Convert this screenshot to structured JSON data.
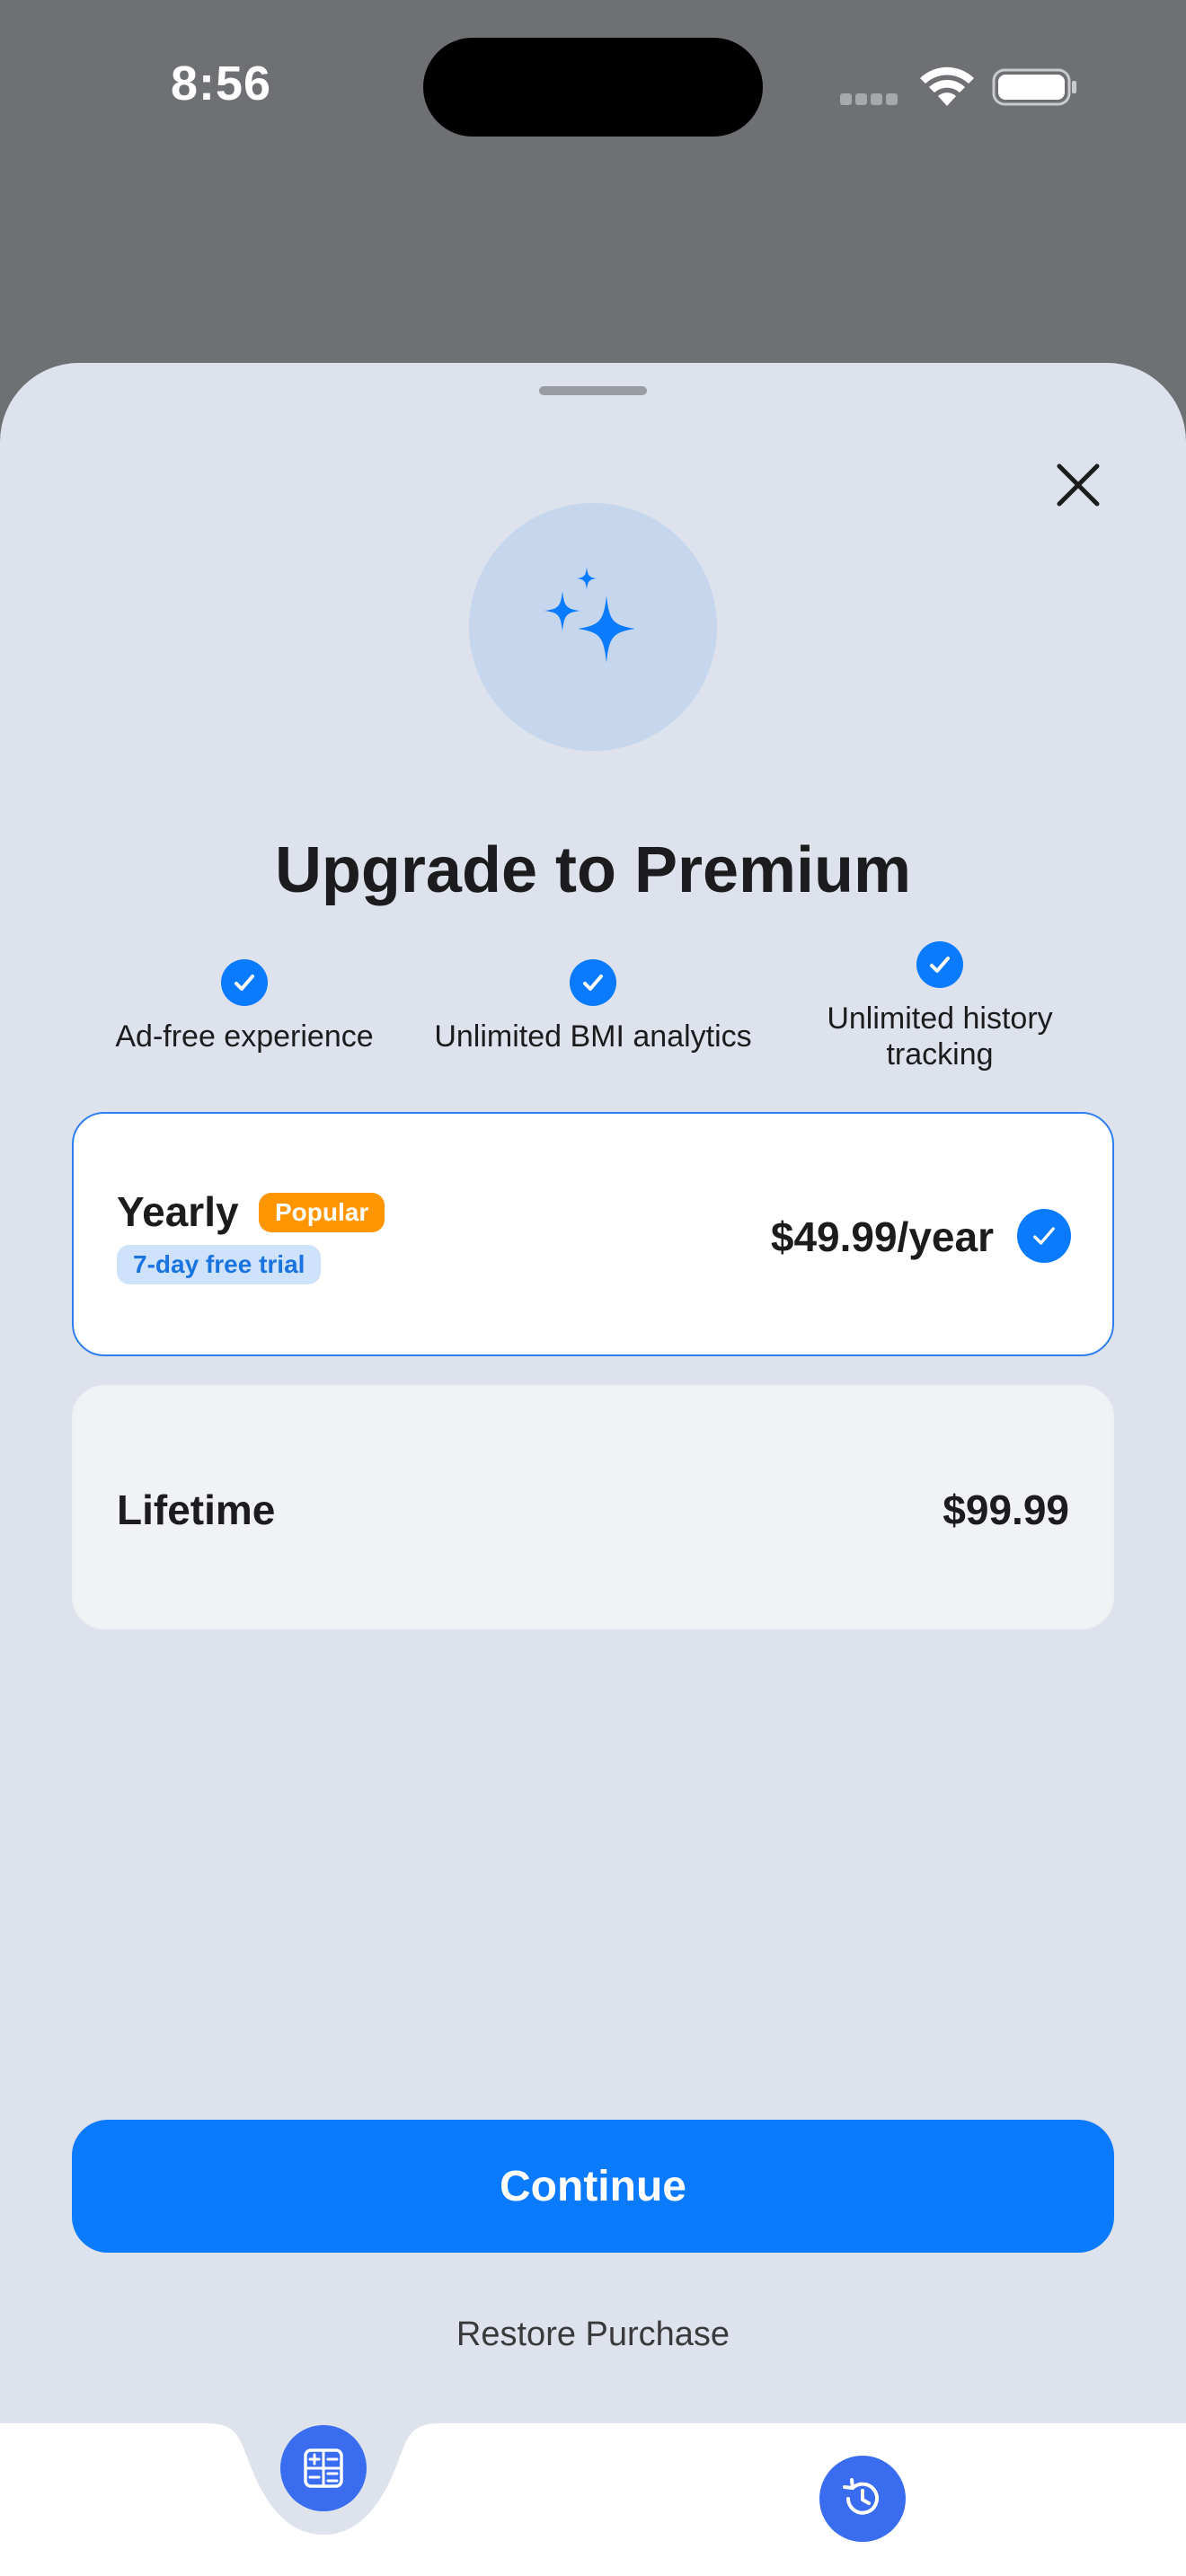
{
  "status_bar": {
    "time": "8:56",
    "wifi_icon": "wifi-icon",
    "battery_icon": "battery-icon"
  },
  "colors": {
    "accent": "#0a7aff",
    "sheet_background": "#dde2ed",
    "popular_badge": "#ff9500",
    "trial_badge_bg": "#cfe2fb"
  },
  "paywall": {
    "hero_icon": "sparkles-icon",
    "close_icon": "close-icon",
    "title": "Upgrade to Premium",
    "features": [
      {
        "label": "Ad-free experience",
        "icon": "checkmark-icon"
      },
      {
        "label": "Unlimited BMI analytics",
        "icon": "checkmark-icon"
      },
      {
        "label": "Unlimited history tracking",
        "icon": "checkmark-icon"
      }
    ],
    "plans": [
      {
        "name": "Yearly",
        "badge": "Popular",
        "trial": "7-day free trial",
        "price": "$49.99/year",
        "selected": true
      },
      {
        "name": "Lifetime",
        "price": "$99.99",
        "selected": false
      }
    ],
    "continue_label": "Continue",
    "restore_label": "Restore Purchase"
  },
  "tab_bar": {
    "items": [
      {
        "icon": "calculator-icon",
        "active": true
      },
      {
        "icon": "history-icon",
        "active": false
      }
    ]
  }
}
